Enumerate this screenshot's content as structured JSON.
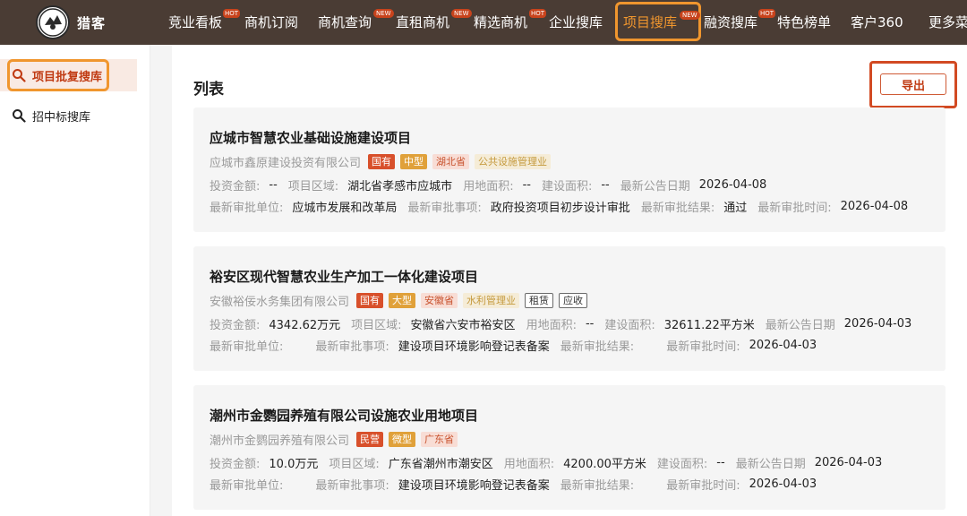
{
  "brand": {
    "name": "猎客"
  },
  "nav": {
    "items": [
      {
        "label": "竞业看板",
        "badge": "HOT"
      },
      {
        "label": "商机订阅",
        "badge": ""
      },
      {
        "label": "商机查询",
        "badge": "NEW"
      },
      {
        "label": "直租商机",
        "badge": "NEW"
      },
      {
        "label": "精选商机",
        "badge": "HOT"
      },
      {
        "label": "企业搜库",
        "badge": ""
      },
      {
        "label": "项目搜库",
        "badge": "NEW",
        "active": true
      },
      {
        "label": "融资搜库",
        "badge": "HOT"
      },
      {
        "label": "特色榜单",
        "badge": ""
      },
      {
        "label": "客户360",
        "badge": ""
      },
      {
        "label": "更多菜",
        "badge": ""
      }
    ]
  },
  "sidebar": {
    "items": [
      {
        "label": "项目批复搜库",
        "active": true
      },
      {
        "label": "招中标搜库",
        "active": false
      }
    ]
  },
  "main": {
    "title": "列表",
    "export_label": "导出"
  },
  "labels": {
    "invest": "投资金额:",
    "region": "项目区域:",
    "land_area": "用地面积:",
    "build_area": "建设面积:",
    "latest_date": "最新公告日期",
    "approval_unit": "最新审批单位:",
    "approval_item": "最新审批事项:",
    "approval_result": "最新审批结果:",
    "approval_time": "最新审批时间:"
  },
  "cards": [
    {
      "title": "应城市智慧农业基础设施建设项目",
      "company": "应城市鑫原建设投资有限公司",
      "tags": [
        {
          "text": "国有",
          "style": "red"
        },
        {
          "text": "中型",
          "style": "gold"
        },
        {
          "text": "湖北省",
          "style": "pink"
        },
        {
          "text": "公共设施管理业",
          "style": "beige"
        }
      ],
      "invest": "--",
      "region": "湖北省孝感市应城市",
      "land_area": "--",
      "build_area": "--",
      "latest_date": "2026-04-08",
      "approval_unit": "应城市发展和改革局",
      "approval_item": "政府投资项目初步设计审批",
      "approval_result": "通过",
      "approval_time": "2026-04-08"
    },
    {
      "title": "裕安区现代智慧农业生产加工一体化建设项目",
      "company": "安徽裕佞水务集团有限公司",
      "tags": [
        {
          "text": "国有",
          "style": "red"
        },
        {
          "text": "大型",
          "style": "gold"
        },
        {
          "text": "安徽省",
          "style": "pink"
        },
        {
          "text": "水利管理业",
          "style": "beige"
        },
        {
          "text": "租赁",
          "style": "outline"
        },
        {
          "text": "应收",
          "style": "outline"
        }
      ],
      "invest": "4342.62万元",
      "region": "安徽省六安市裕安区",
      "land_area": "--",
      "build_area": "32611.22平方米",
      "latest_date": "2026-04-03",
      "approval_unit": "",
      "approval_item": "建设项目环境影响登记表备案",
      "approval_result": "",
      "approval_time": "2026-04-03"
    },
    {
      "title": "潮州市金鹦园养殖有限公司设施农业用地项目",
      "company": "潮州市金鹦园养殖有限公司",
      "tags": [
        {
          "text": "民营",
          "style": "red"
        },
        {
          "text": "微型",
          "style": "gold"
        },
        {
          "text": "广东省",
          "style": "pink"
        }
      ],
      "invest": "10.0万元",
      "region": "广东省潮州市潮安区",
      "land_area": "4200.00平方米",
      "build_area": "--",
      "latest_date": "2026-04-03",
      "approval_unit": "",
      "approval_item": "建设项目环境影响登记表备案",
      "approval_result": "",
      "approval_time": "2026-04-03"
    }
  ],
  "colors": {
    "topbar": "#4a3c34",
    "accent": "#f0962e",
    "brand_red": "#c03a12"
  }
}
